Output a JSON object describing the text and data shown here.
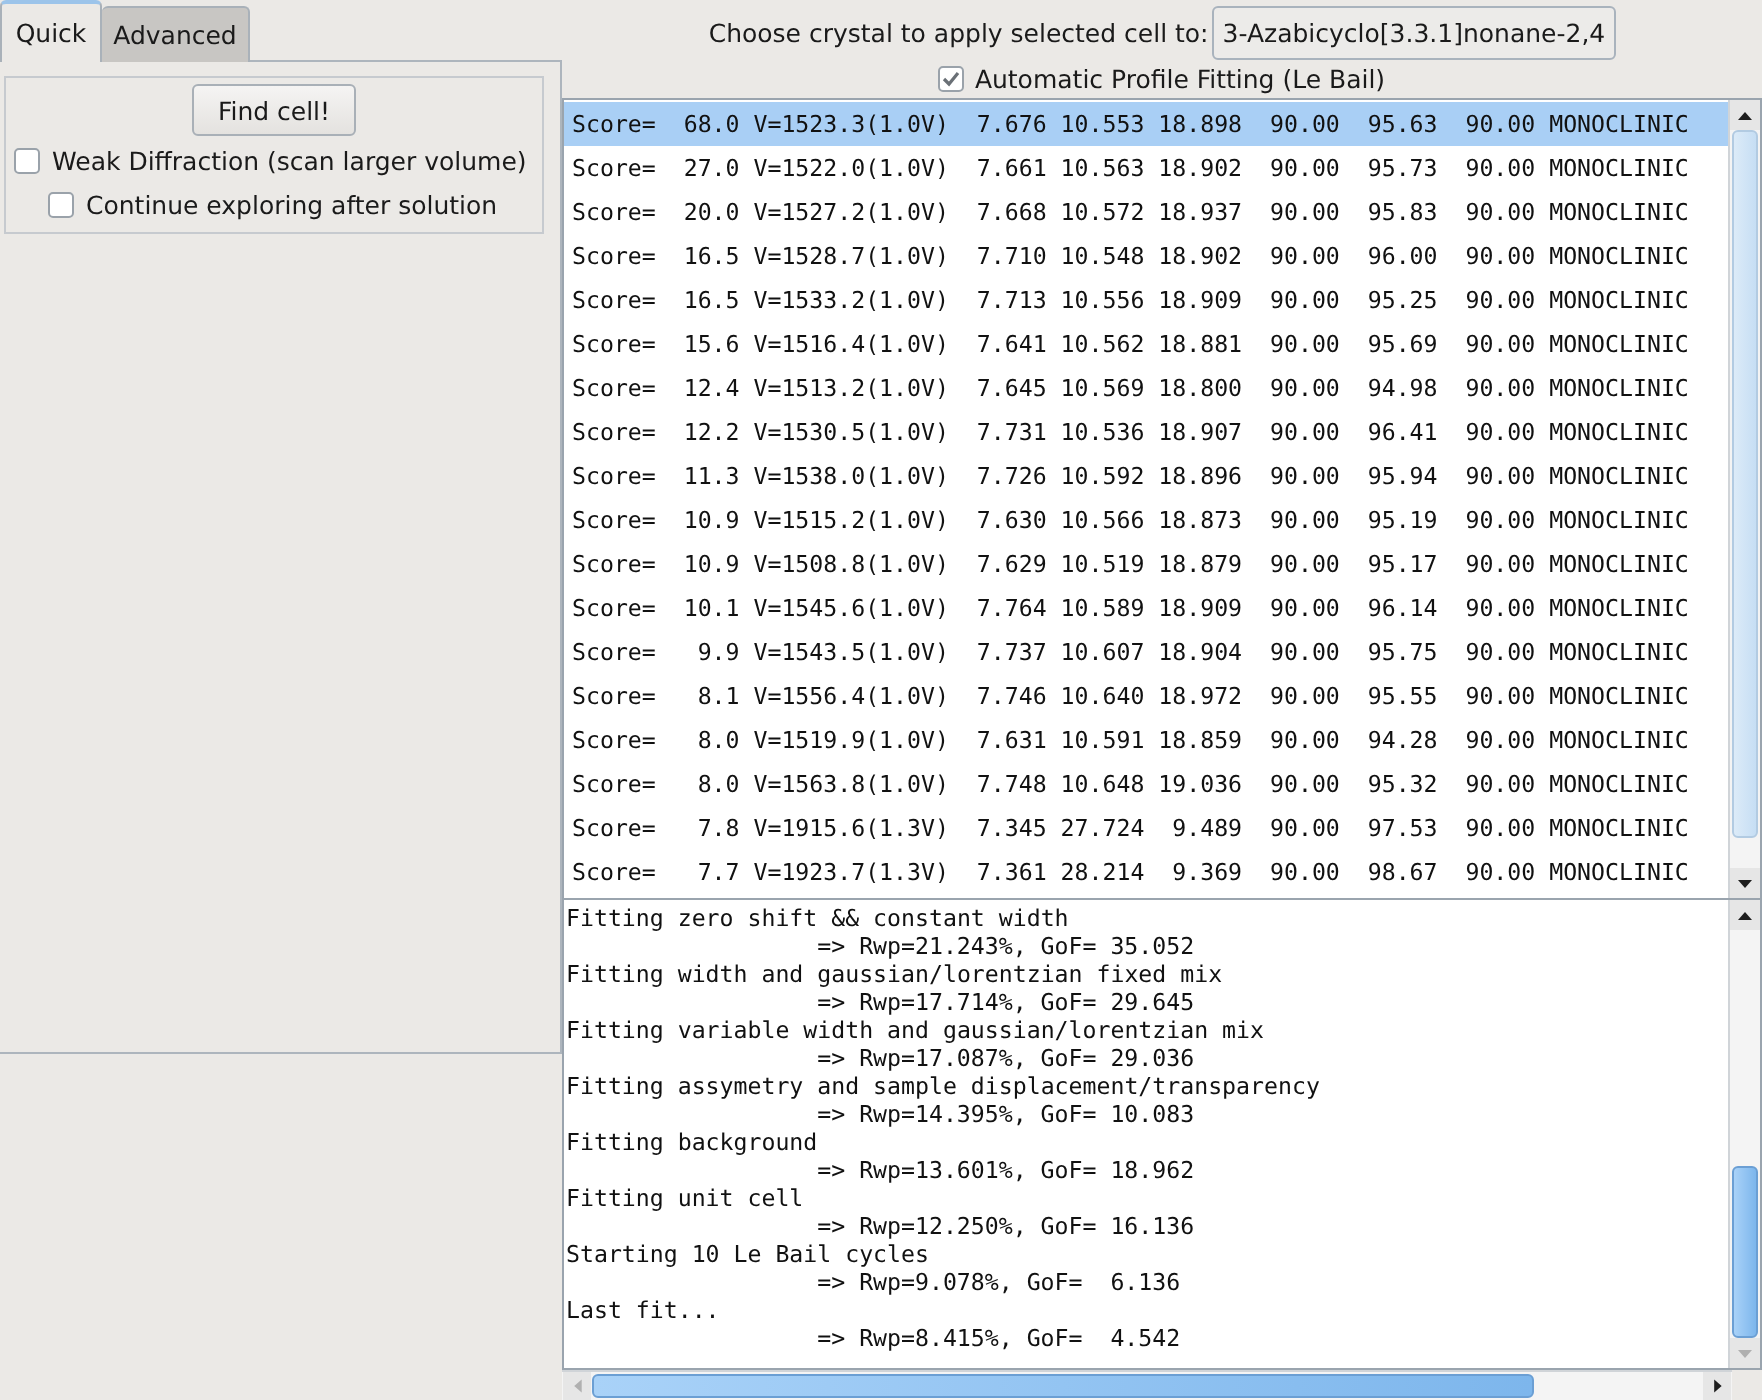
{
  "tabs": [
    {
      "label": "Quick",
      "selected": true
    },
    {
      "label": "Advanced",
      "selected": false
    }
  ],
  "quick_tab": {
    "find_button": "Find cell!",
    "weak_diffraction": {
      "label": "Weak Diffraction (scan larger volume)",
      "checked": false
    },
    "continue_exploring": {
      "label": "Continue exploring after solution",
      "checked": false
    }
  },
  "crystal_chooser": {
    "label": "Choose crystal to apply selected cell to:",
    "value": "3-Azabicyclo[3.3.1]nonane-2,4"
  },
  "profile_fitting": {
    "label": "Automatic Profile Fitting (Le Bail)",
    "checked": true
  },
  "cell_list": {
    "rows": [
      {
        "text": "Score=  68.0 V=1523.3(1.0V)  7.676 10.553 18.898  90.00  95.63  90.00 MONOCLINIC",
        "selected": true
      },
      {
        "text": "Score=  27.0 V=1522.0(1.0V)  7.661 10.563 18.902  90.00  95.73  90.00 MONOCLINIC",
        "selected": false
      },
      {
        "text": "Score=  20.0 V=1527.2(1.0V)  7.668 10.572 18.937  90.00  95.83  90.00 MONOCLINIC",
        "selected": false
      },
      {
        "text": "Score=  16.5 V=1528.7(1.0V)  7.710 10.548 18.902  90.00  96.00  90.00 MONOCLINIC",
        "selected": false
      },
      {
        "text": "Score=  16.5 V=1533.2(1.0V)  7.713 10.556 18.909  90.00  95.25  90.00 MONOCLINIC",
        "selected": false
      },
      {
        "text": "Score=  15.6 V=1516.4(1.0V)  7.641 10.562 18.881  90.00  95.69  90.00 MONOCLINIC",
        "selected": false
      },
      {
        "text": "Score=  12.4 V=1513.2(1.0V)  7.645 10.569 18.800  90.00  94.98  90.00 MONOCLINIC",
        "selected": false
      },
      {
        "text": "Score=  12.2 V=1530.5(1.0V)  7.731 10.536 18.907  90.00  96.41  90.00 MONOCLINIC",
        "selected": false
      },
      {
        "text": "Score=  11.3 V=1538.0(1.0V)  7.726 10.592 18.896  90.00  95.94  90.00 MONOCLINIC",
        "selected": false
      },
      {
        "text": "Score=  10.9 V=1515.2(1.0V)  7.630 10.566 18.873  90.00  95.19  90.00 MONOCLINIC",
        "selected": false
      },
      {
        "text": "Score=  10.9 V=1508.8(1.0V)  7.629 10.519 18.879  90.00  95.17  90.00 MONOCLINIC",
        "selected": false
      },
      {
        "text": "Score=  10.1 V=1545.6(1.0V)  7.764 10.589 18.909  90.00  96.14  90.00 MONOCLINIC",
        "selected": false
      },
      {
        "text": "Score=   9.9 V=1543.5(1.0V)  7.737 10.607 18.904  90.00  95.75  90.00 MONOCLINIC",
        "selected": false
      },
      {
        "text": "Score=   8.1 V=1556.4(1.0V)  7.746 10.640 18.972  90.00  95.55  90.00 MONOCLINIC",
        "selected": false
      },
      {
        "text": "Score=   8.0 V=1519.9(1.0V)  7.631 10.591 18.859  90.00  94.28  90.00 MONOCLINIC",
        "selected": false
      },
      {
        "text": "Score=   8.0 V=1563.8(1.0V)  7.748 10.648 19.036  90.00  95.32  90.00 MONOCLINIC",
        "selected": false
      },
      {
        "text": "Score=   7.8 V=1915.6(1.3V)  7.345 27.724  9.489  90.00  97.53  90.00 MONOCLINIC",
        "selected": false
      },
      {
        "text": "Score=   7.7 V=1923.7(1.3V)  7.361 28.214  9.369  90.00  98.67  90.00 MONOCLINIC",
        "selected": false
      }
    ]
  },
  "log": [
    {
      "step": "Fitting zero shift && constant width",
      "result": "=> Rwp=21.243%, GoF= 35.052"
    },
    {
      "step": "Fitting width and gaussian/lorentzian fixed mix",
      "result": "=> Rwp=17.714%, GoF= 29.645"
    },
    {
      "step": "Fitting variable width and gaussian/lorentzian mix",
      "result": "=> Rwp=17.087%, GoF= 29.036"
    },
    {
      "step": "Fitting assymetry and sample displacement/transparency",
      "result": "=> Rwp=14.395%, GoF= 10.083"
    },
    {
      "step": "Fitting background",
      "result": "=> Rwp=13.601%, GoF= 18.962"
    },
    {
      "step": "Fitting unit cell",
      "result": "=> Rwp=12.250%, GoF= 16.136"
    },
    {
      "step": "Starting 10 Le Bail cycles",
      "result": "=> Rwp=9.078%, GoF=  6.136"
    },
    {
      "step": "Last fit...",
      "result": "=> Rwp=8.415%, GoF=  4.542"
    }
  ]
}
